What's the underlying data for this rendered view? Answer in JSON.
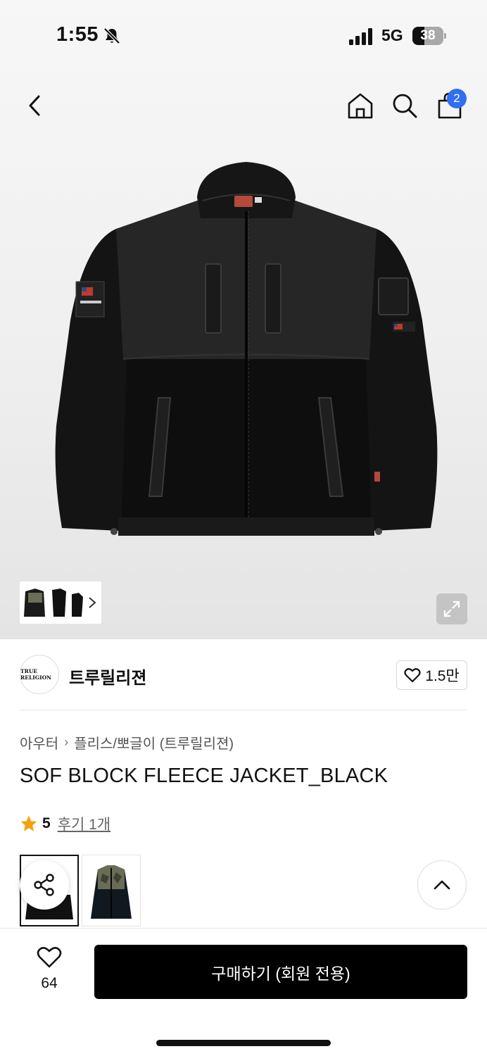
{
  "status_bar": {
    "time": "1:55",
    "network": "5G",
    "battery": "38",
    "battery_level": 0.38
  },
  "header": {
    "icons": [
      "chevron-left-icon",
      "home-icon",
      "search-icon",
      "shopping-bag-icon"
    ],
    "cart_count": "2"
  },
  "gallery": {
    "thumbnail_count": 3
  },
  "brand": {
    "logo_text": "TRUE RELIGION",
    "name": "트루릴리젼",
    "likes": "1.5만"
  },
  "product": {
    "breadcrumb": [
      "아우터",
      "플리스/뽀글이 (트루릴리젼)"
    ],
    "title": "SOF BLOCK FLEECE JACKET_BLACK",
    "rating": "5",
    "reviews": "후기 1개"
  },
  "bottom_bar": {
    "wish_count": "64",
    "buy_label": "구매하기 (회원 전용)"
  },
  "colors": {
    "accent": "#2f6ff0",
    "star": "#f5a00f",
    "button": "#000000"
  }
}
